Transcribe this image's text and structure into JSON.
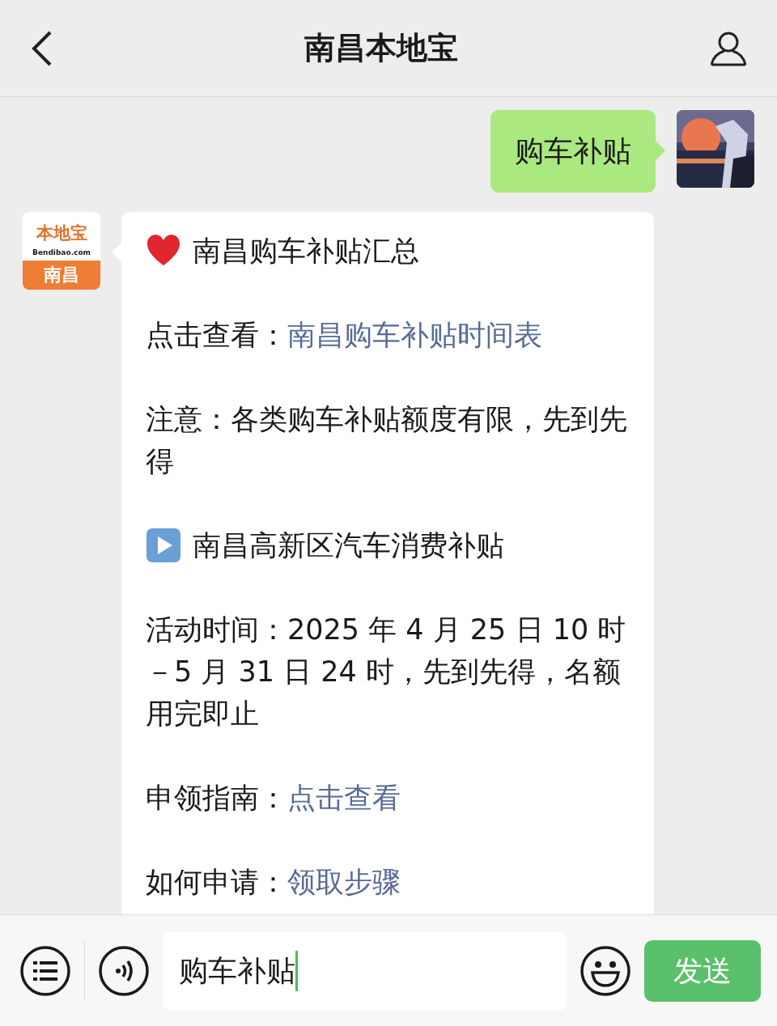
{
  "header": {
    "title": "南昌本地宝"
  },
  "messages": [
    {
      "kind": "sent",
      "text": "购车补贴"
    },
    {
      "kind": "received",
      "logo": {
        "brand": "本地宝",
        "domain": "Bendibao.com",
        "city": "南昌"
      },
      "paragraphs": [
        {
          "kind": "heading",
          "text": "南昌购车补贴汇总"
        },
        {
          "kind": "link",
          "label": "点击查看：",
          "link": "南昌购车补贴时间表"
        },
        {
          "kind": "text",
          "text": "注意：各类购车补贴额度有限，先到先得"
        },
        {
          "kind": "section",
          "text": "南昌高新区汽车消费补贴"
        },
        {
          "kind": "text",
          "text": "活动时间：2025 年 4 月 25 日 10 时－5 月 31 日 24 时，先到先得，名额用完即止"
        },
        {
          "kind": "link",
          "label": "申领指南：",
          "link": "点击查看"
        },
        {
          "kind": "link",
          "label": "如何申请：",
          "link": "领取步骤"
        }
      ]
    }
  ],
  "composer": {
    "value": "购车补贴",
    "send": "发送"
  }
}
